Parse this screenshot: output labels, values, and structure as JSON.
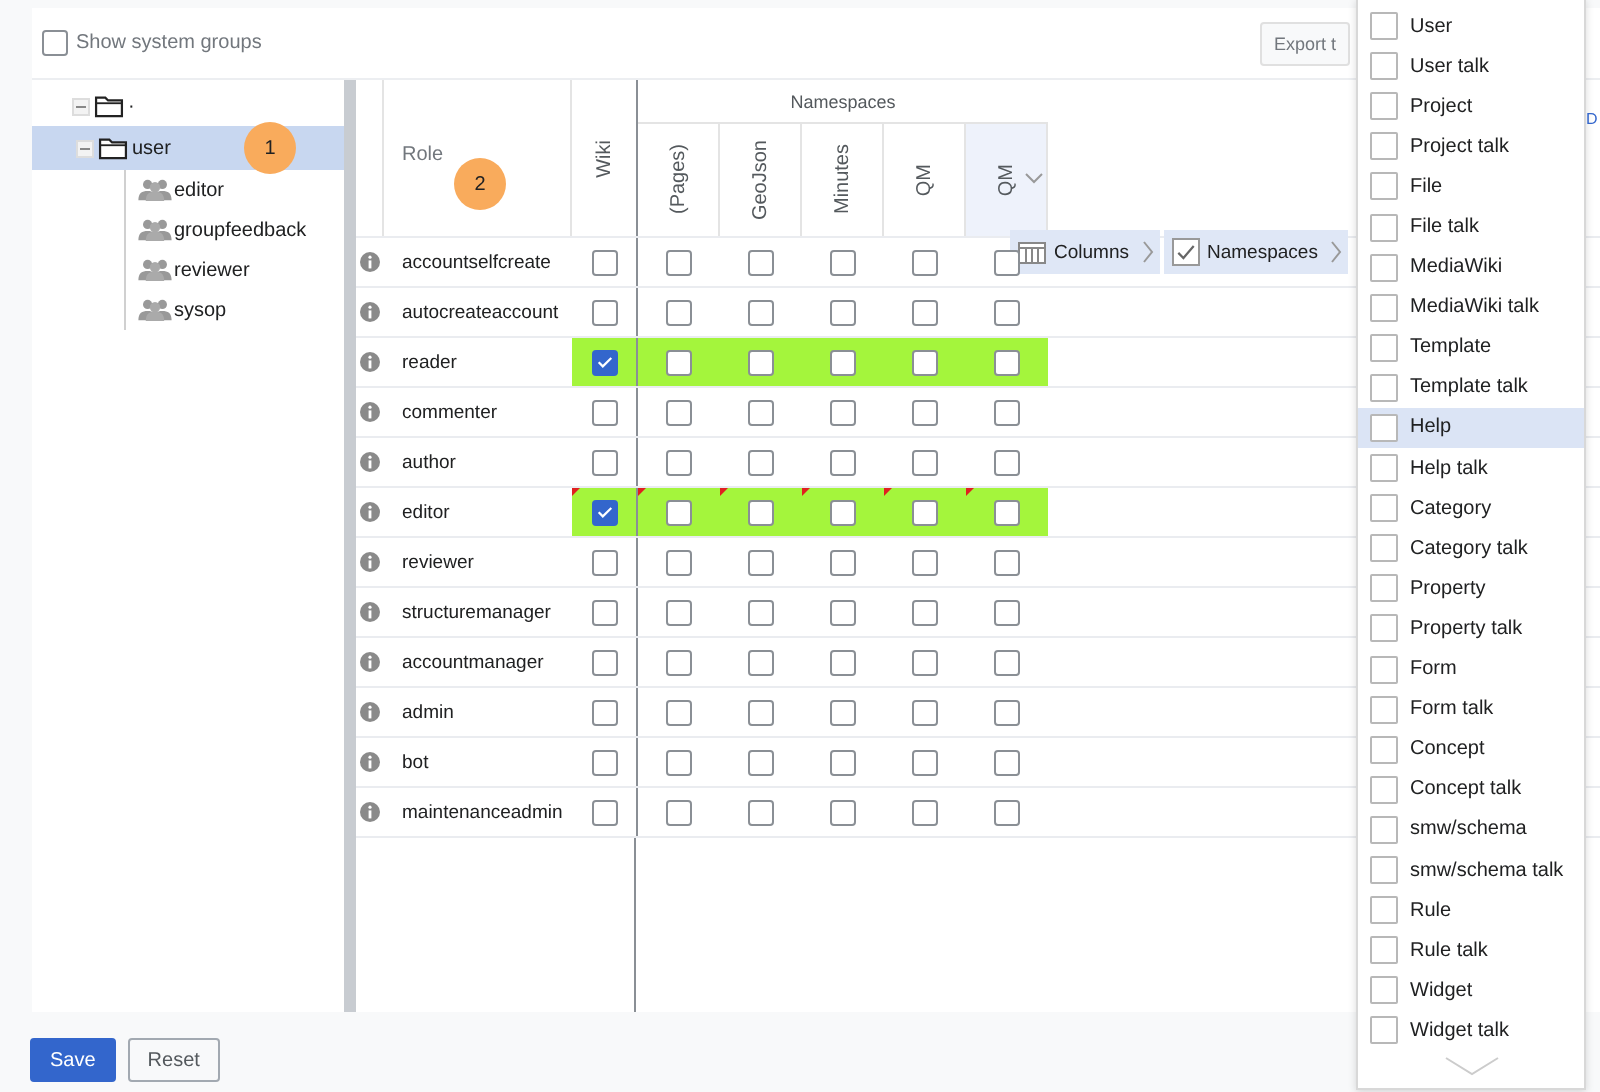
{
  "show_system_groups": {
    "label": "Show system groups",
    "checked": false
  },
  "export_button": "Export t",
  "tree": {
    "label": "·",
    "expanded": true,
    "selected": false,
    "children": [
      {
        "label": "user",
        "expanded": true,
        "selected": true,
        "children": [
          {
            "label": "editor"
          },
          {
            "label": "groupfeedback"
          },
          {
            "label": "reviewer"
          },
          {
            "label": "sysop"
          }
        ]
      }
    ]
  },
  "badges": [
    "1",
    "2"
  ],
  "grid": {
    "role_header": "Role",
    "group_header": "Namespaces",
    "columns": [
      {
        "label": "Wiki",
        "kind": "wiki",
        "highlighted": false
      },
      {
        "label": "(Pages)",
        "kind": "namespace",
        "highlighted": false
      },
      {
        "label": "GeoJson",
        "kind": "namespace",
        "highlighted": false
      },
      {
        "label": "Minutes",
        "kind": "namespace",
        "highlighted": false
      },
      {
        "label": "QM",
        "kind": "namespace",
        "highlighted": false
      },
      {
        "label": "QM",
        "kind": "namespace",
        "highlighted": true
      }
    ],
    "rows": [
      {
        "role": "accountselfcreate",
        "highlighted": false,
        "changed": false,
        "values": [
          false,
          false,
          false,
          false,
          false,
          false
        ]
      },
      {
        "role": "autocreateaccount",
        "highlighted": false,
        "changed": false,
        "values": [
          false,
          false,
          false,
          false,
          false,
          false
        ]
      },
      {
        "role": "reader",
        "highlighted": true,
        "changed": false,
        "values": [
          true,
          false,
          false,
          false,
          false,
          false
        ]
      },
      {
        "role": "commenter",
        "highlighted": false,
        "changed": false,
        "values": [
          false,
          false,
          false,
          false,
          false,
          false
        ]
      },
      {
        "role": "author",
        "highlighted": false,
        "changed": false,
        "values": [
          false,
          false,
          false,
          false,
          false,
          false
        ]
      },
      {
        "role": "editor",
        "highlighted": true,
        "changed": true,
        "values": [
          true,
          false,
          false,
          false,
          false,
          false
        ]
      },
      {
        "role": "reviewer",
        "highlighted": false,
        "changed": false,
        "values": [
          false,
          false,
          false,
          false,
          false,
          false
        ]
      },
      {
        "role": "structuremanager",
        "highlighted": false,
        "changed": false,
        "values": [
          false,
          false,
          false,
          false,
          false,
          false
        ]
      },
      {
        "role": "accountmanager",
        "highlighted": false,
        "changed": false,
        "values": [
          false,
          false,
          false,
          false,
          false,
          false
        ]
      },
      {
        "role": "admin",
        "highlighted": false,
        "changed": false,
        "values": [
          false,
          false,
          false,
          false,
          false,
          false
        ]
      },
      {
        "role": "bot",
        "highlighted": false,
        "changed": false,
        "values": [
          false,
          false,
          false,
          false,
          false,
          false
        ]
      },
      {
        "role": "maintenanceadmin",
        "highlighted": false,
        "changed": false,
        "values": [
          false,
          false,
          false,
          false,
          false,
          false
        ]
      }
    ]
  },
  "column_menu": {
    "items": [
      {
        "label": "Columns",
        "kind": "table"
      },
      {
        "label": "Namespaces",
        "kind": "checkbox",
        "checked": true
      }
    ]
  },
  "namespace_list": {
    "items": [
      {
        "label": "User",
        "checked": false,
        "selected": false
      },
      {
        "label": "User talk",
        "checked": false,
        "selected": false
      },
      {
        "label": "Project",
        "checked": false,
        "selected": false
      },
      {
        "label": "Project talk",
        "checked": false,
        "selected": false
      },
      {
        "label": "File",
        "checked": false,
        "selected": false
      },
      {
        "label": "File talk",
        "checked": false,
        "selected": false
      },
      {
        "label": "MediaWiki",
        "checked": false,
        "selected": false
      },
      {
        "label": "MediaWiki talk",
        "checked": false,
        "selected": false
      },
      {
        "label": "Template",
        "checked": false,
        "selected": false
      },
      {
        "label": "Template talk",
        "checked": false,
        "selected": false
      },
      {
        "label": "Help",
        "checked": false,
        "selected": true
      },
      {
        "label": "Help talk",
        "checked": false,
        "selected": false
      },
      {
        "label": "Category",
        "checked": false,
        "selected": false
      },
      {
        "label": "Category talk",
        "checked": false,
        "selected": false
      },
      {
        "label": "Property",
        "checked": false,
        "selected": false
      },
      {
        "label": "Property talk",
        "checked": false,
        "selected": false
      },
      {
        "label": "Form",
        "checked": false,
        "selected": false
      },
      {
        "label": "Form talk",
        "checked": false,
        "selected": false
      },
      {
        "label": "Concept",
        "checked": false,
        "selected": false
      },
      {
        "label": "Concept talk",
        "checked": false,
        "selected": false
      },
      {
        "label": "smw/schema",
        "checked": false,
        "selected": false
      },
      {
        "label": "smw/schema talk",
        "checked": false,
        "selected": false
      },
      {
        "label": "Rule",
        "checked": false,
        "selected": false
      },
      {
        "label": "Rule talk",
        "checked": false,
        "selected": false
      },
      {
        "label": "Widget",
        "checked": false,
        "selected": false
      },
      {
        "label": "Widget talk",
        "checked": false,
        "selected": false
      }
    ]
  },
  "edge_text": "D",
  "buttons": [
    {
      "label": "Save",
      "kind": "primary"
    },
    {
      "label": "Reset",
      "kind": "secondary"
    }
  ]
}
